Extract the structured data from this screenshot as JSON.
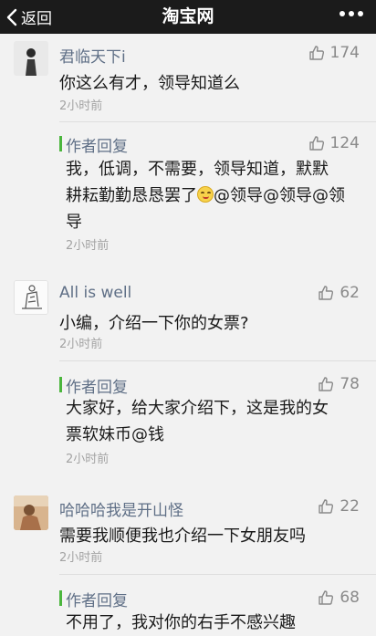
{
  "navbar": {
    "back_label": "返回",
    "title": "淘宝网"
  },
  "comments": [
    {
      "user": "君临天下i",
      "likes": "174",
      "text": "你这么有才，领导知道么",
      "time": "2小时前",
      "reply": {
        "label": "作者回复",
        "likes": "124",
        "line1": "我，低调，不需要，领导知道，默默",
        "line2a": "耕耘勤勤恳恳罢了",
        "line2b": "@领导@领导@领",
        "line3": "导",
        "time": "2小时前"
      }
    },
    {
      "user": "All is well",
      "likes": "62",
      "text": "小编，介绍一下你的女票?",
      "time": "2小时前",
      "reply": {
        "label": "作者回复",
        "likes": "78",
        "line1": "大家好，给大家介绍下，这是我的女",
        "line2": "票软妹币@钱",
        "time": "2小时前"
      }
    },
    {
      "user": "哈哈哈我是开山怪",
      "likes": "22",
      "text": "需要我顺便我也介绍一下女朋友吗",
      "time": "2小时前",
      "reply": {
        "label": "作者回复",
        "likes": "68",
        "line1": "不用了，我对你的右手不感兴趣"
      }
    }
  ],
  "colors": {
    "navbar": "#1b1b1b",
    "username": "#5f6f86",
    "reply_bar": "#4bb63d",
    "time": "#a3a3a3"
  }
}
